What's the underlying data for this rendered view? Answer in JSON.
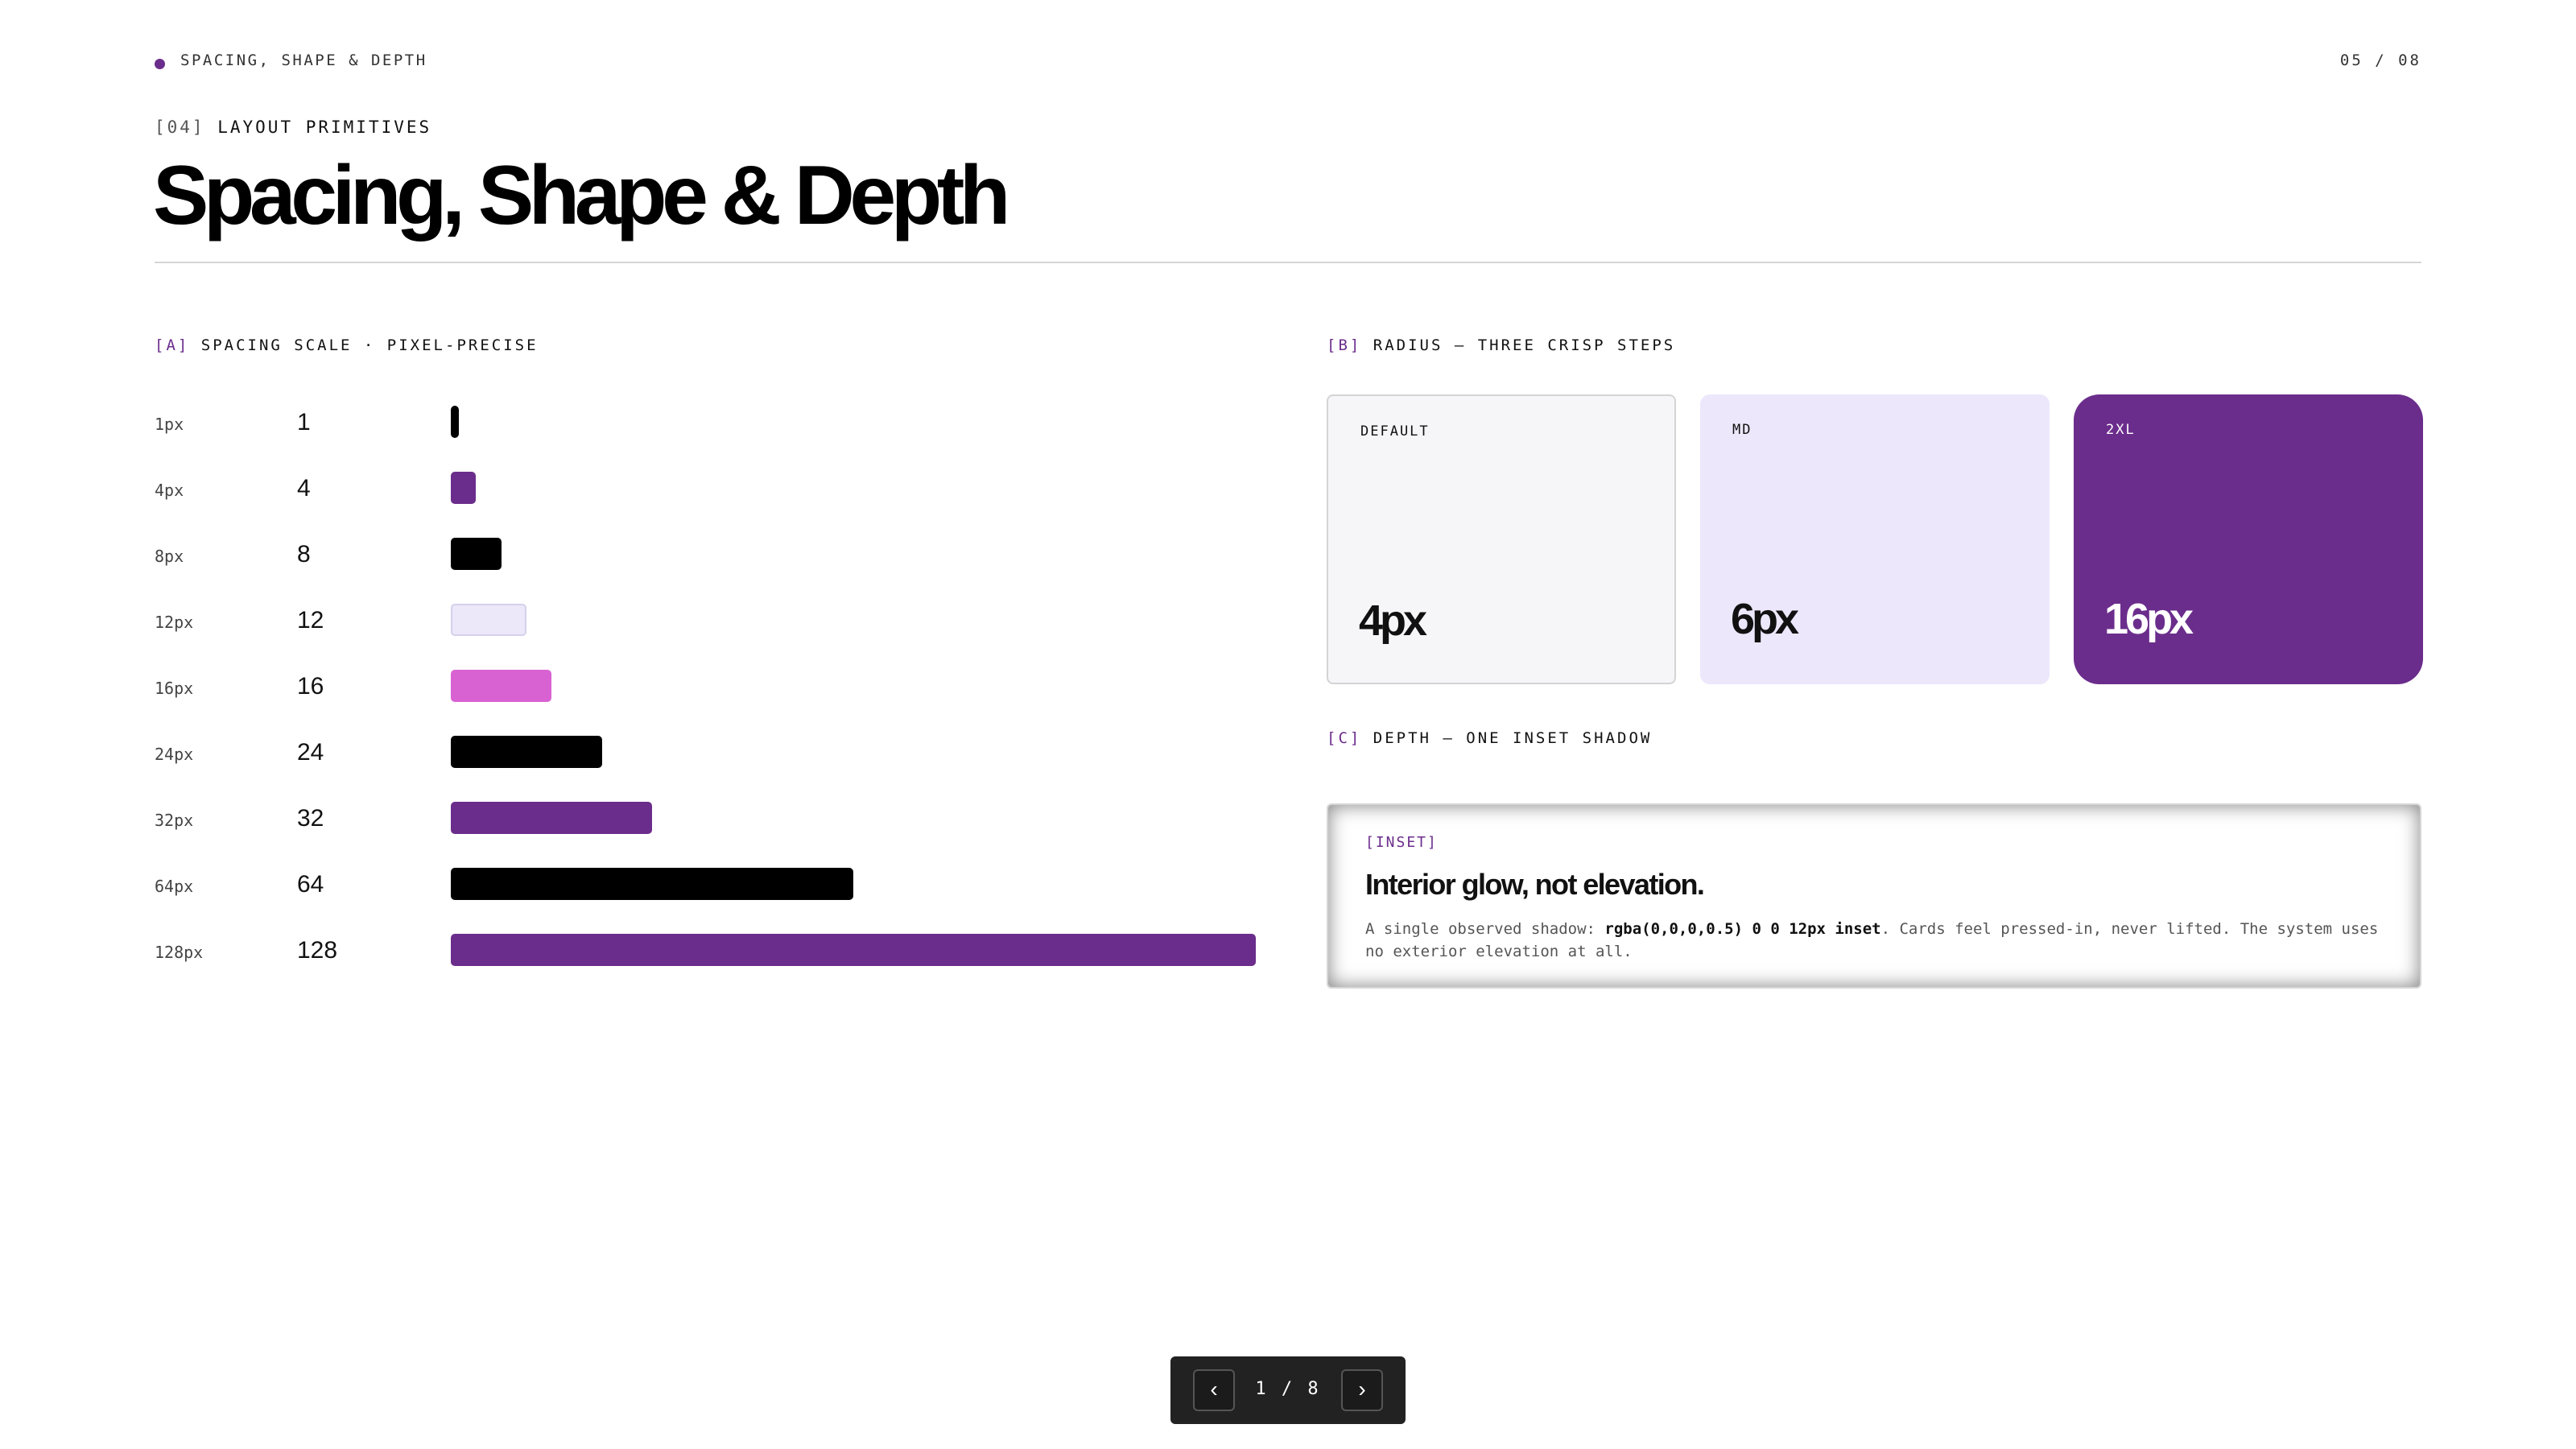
{
  "header": {
    "breadcrumb": "SPACING, SHAPE & DEPTH",
    "page_indicator": "05 / 08",
    "eyebrow_tag": "[04]",
    "eyebrow_label": "LAYOUT PRIMITIVES",
    "title": "Spacing, Shape & Depth"
  },
  "spacing": {
    "tag": "[A]",
    "label": "SPACING SCALE · PIXEL-PRECISE",
    "rows": [
      {
        "px": "1px",
        "value": "1",
        "num": 1,
        "color": "#000000"
      },
      {
        "px": "4px",
        "value": "4",
        "num": 4,
        "color": "#6b2d8c"
      },
      {
        "px": "8px",
        "value": "8",
        "num": 8,
        "color": "#000000"
      },
      {
        "px": "12px",
        "value": "12",
        "num": 12,
        "color": "#ece8fa"
      },
      {
        "px": "16px",
        "value": "16",
        "num": 16,
        "color": "#d962d3"
      },
      {
        "px": "24px",
        "value": "24",
        "num": 24,
        "color": "#000000"
      },
      {
        "px": "32px",
        "value": "32",
        "num": 32,
        "color": "#6b2d8c"
      },
      {
        "px": "64px",
        "value": "64",
        "num": 64,
        "color": "#000000"
      },
      {
        "px": "128px",
        "value": "128",
        "num": 128,
        "color": "#6b2d8c"
      }
    ]
  },
  "radius": {
    "tag": "[B]",
    "label": "RADIUS — THREE CRISP STEPS",
    "cards": [
      {
        "name": "DEFAULT",
        "value": "4px",
        "bg": "#f6f5f8",
        "fg": "#111111"
      },
      {
        "name": "MD",
        "value": "6px",
        "bg": "#ece7fb",
        "fg": "#111111"
      },
      {
        "name": "2XL",
        "value": "16px",
        "bg": "#6b2d8c",
        "fg": "#ffffff"
      }
    ]
  },
  "depth": {
    "tag": "[C]",
    "label": "DEPTH — ONE INSET SHADOW",
    "card_tag": "[INSET]",
    "heading": "Interior glow, not elevation.",
    "body_prefix": "A single observed shadow: ",
    "body_code": "rgba(0,0,0,0.5) 0 0 12px inset",
    "body_suffix": ". Cards feel pressed-in, never lifted. The system uses no exterior elevation at all."
  },
  "pager": {
    "prev": "‹",
    "next": "›",
    "count": "1 / 8"
  },
  "colors": {
    "accent": "#6b2d8c",
    "pink": "#d962d3",
    "lavender": "#ece7fb"
  }
}
